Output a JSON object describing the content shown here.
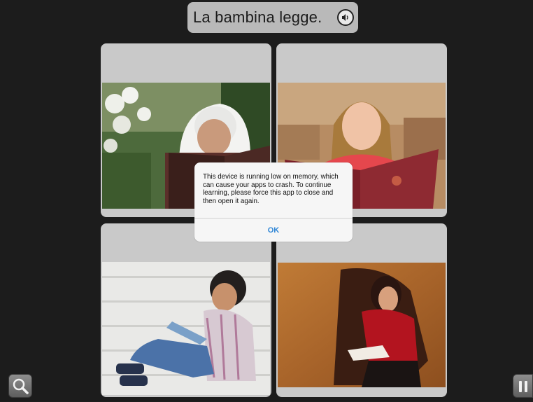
{
  "prompt": {
    "text": "La bambina legge."
  },
  "alert": {
    "message": "This device is running low on memory, which can cause your apps to crash. To continue learning, please force this app to close and then open it again.",
    "ok_label": "OK"
  },
  "colors": {
    "accent": "#2f86d6",
    "background": "#1c1c1c",
    "card": "#c9c9c9"
  },
  "icons": {
    "speaker": "speaker-icon",
    "magnifier": "magnifier-icon",
    "pause": "pause-icon"
  }
}
